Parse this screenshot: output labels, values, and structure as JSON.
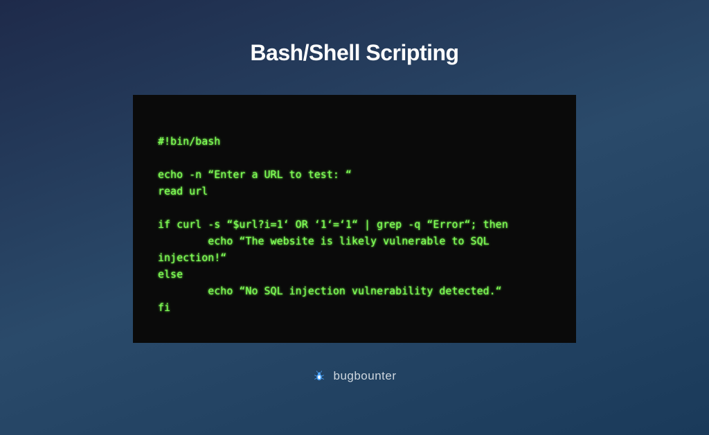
{
  "title": "Bash/Shell Scripting",
  "code": {
    "lines": [
      "#!bin/bash",
      "",
      "echo -n “Enter a URL to test: “",
      "read url",
      "",
      "if curl -s “$url?i=1‘ OR ‘1‘=‘1“ | grep -q “Error“; then",
      "        echo “The website is likely vulnerable to SQL injection!“",
      "else",
      "        echo “No SQL injection vulnerability detected.“",
      "fi"
    ]
  },
  "brand": {
    "name": "bugbounter",
    "icon_colors": {
      "primary": "#4da6ff",
      "accent": "#ffffff"
    }
  }
}
